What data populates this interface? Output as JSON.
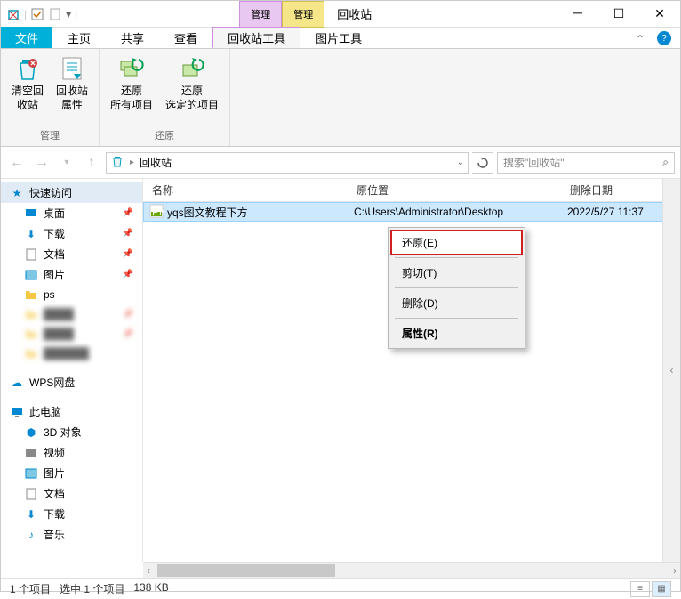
{
  "window": {
    "title": "回收站",
    "mgmt_tab_1": "管理",
    "mgmt_tab_2": "管理"
  },
  "tabs": {
    "file": "文件",
    "home": "主页",
    "share": "共享",
    "view": "查看",
    "recycle_tools": "回收站工具",
    "picture_tools": "图片工具"
  },
  "ribbon": {
    "group_manage": "管理",
    "group_restore": "还原",
    "empty": "清空回\n收站",
    "properties": "回收站\n属性",
    "restore_all": "还原\n所有项目",
    "restore_selected": "还原\n选定的项目"
  },
  "nav": {
    "location": "回收站",
    "search_placeholder": "搜索\"回收站\""
  },
  "columns": {
    "name": "名称",
    "orig_location": "原位置",
    "date_deleted": "删除日期"
  },
  "row": {
    "name": "yqs图文教程下方",
    "location": "C:\\Users\\Administrator\\Desktop",
    "date": "2022/5/27 11:37"
  },
  "context": {
    "restore": "还原(E)",
    "cut": "剪切(T)",
    "delete": "删除(D)",
    "properties": "属性(R)"
  },
  "sidebar": {
    "quick_access": "快速访问",
    "desktop": "桌面",
    "downloads": "下载",
    "documents": "文档",
    "pictures": "图片",
    "ps": "ps",
    "blur1": " ",
    "blur2": " ",
    "blur3": " ",
    "wps": "WPS网盘",
    "this_pc": "此电脑",
    "objects3d": "3D 对象",
    "videos": "视频",
    "pictures2": "图片",
    "documents2": "文档",
    "downloads2": "下载",
    "music": "音乐"
  },
  "status": {
    "items": "1 个项目",
    "selected": "选中 1 个项目",
    "size": "138 KB"
  }
}
